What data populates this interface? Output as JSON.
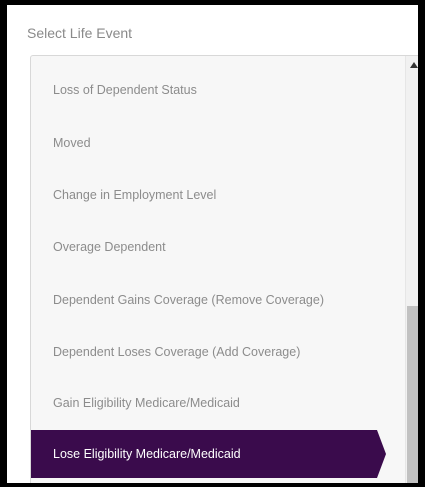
{
  "panel": {
    "title": "Select Life Event"
  },
  "list": {
    "items": [
      {
        "label": "Loss of Dependent Status",
        "selected": false
      },
      {
        "label": "Moved",
        "selected": false
      },
      {
        "label": "Change in Employment Level",
        "selected": false
      },
      {
        "label": "Overage Dependent",
        "selected": false
      },
      {
        "label": "Dependent Gains Coverage (Remove Coverage)",
        "selected": false
      },
      {
        "label": "Dependent Loses Coverage (Add Coverage)",
        "selected": false
      },
      {
        "label": "Gain Eligibility Medicare/Medicaid",
        "selected": false
      },
      {
        "label": "Lose Eligibility Medicare/Medicaid",
        "selected": true
      }
    ]
  },
  "scrollbar": {
    "up_icon": "triangle-up-icon"
  },
  "colors": {
    "selected_bg": "#3a0b4c",
    "selected_text": "#ffffff",
    "item_text": "#8c8c8c",
    "list_bg": "#f7f7f7"
  }
}
